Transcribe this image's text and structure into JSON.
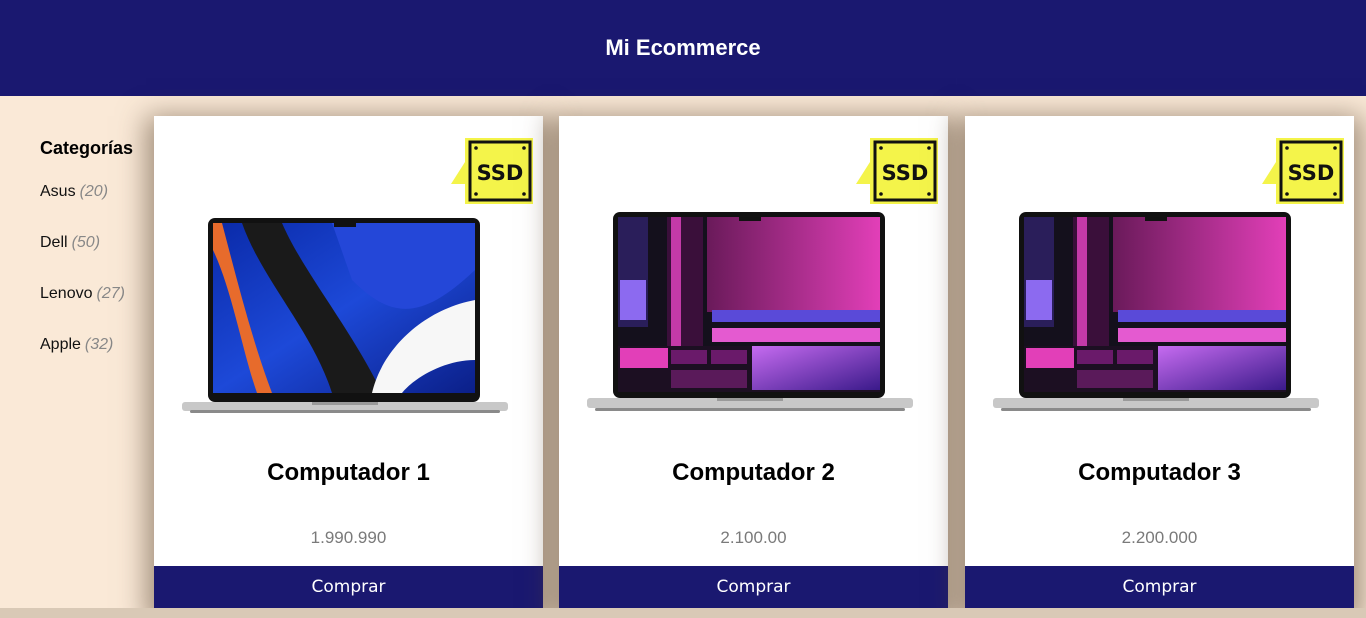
{
  "header": {
    "title": "Mi Ecommerce"
  },
  "sidebar": {
    "heading": "Categorías",
    "items": [
      {
        "label": "Asus",
        "count": "(20)"
      },
      {
        "label": "Dell",
        "count": "(50)"
      },
      {
        "label": "Lenovo",
        "count": "(27)"
      },
      {
        "label": "Apple",
        "count": "(32)"
      }
    ]
  },
  "products": [
    {
      "title": "Computador 1",
      "price": "1.990.990",
      "button": "Comprar",
      "badge": "SSD",
      "image": "macbook-blue-wallpaper"
    },
    {
      "title": "Computador 2",
      "price": "2.100.00",
      "button": "Comprar",
      "badge": "SSD",
      "image": "macbook-purple-wallpaper"
    },
    {
      "title": "Computador 3",
      "price": "2.200.000",
      "button": "Comprar",
      "badge": "SSD",
      "image": "macbook-purple-wallpaper"
    }
  ],
  "colors": {
    "header_bg": "#1a1870",
    "page_bg": "#fae9d7",
    "button_bg": "#1a1870",
    "badge_bg": "#f4f44a",
    "price_text": "#7a7a7a"
  }
}
